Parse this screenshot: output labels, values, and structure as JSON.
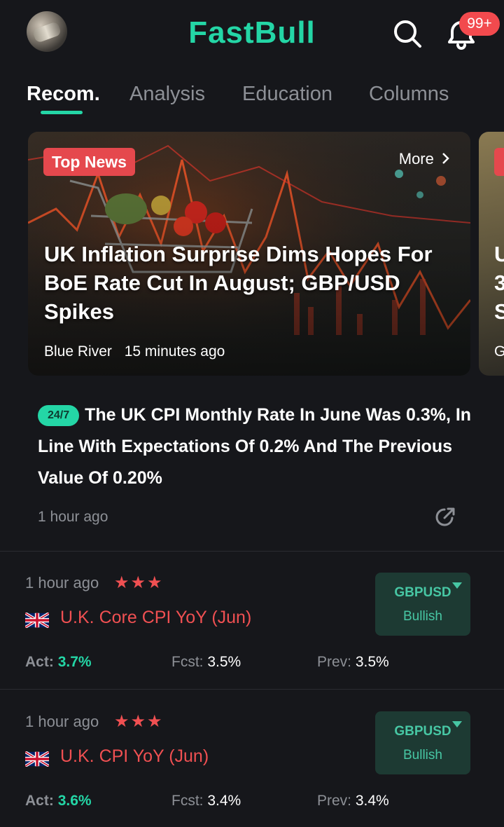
{
  "header": {
    "logo": "FastBull",
    "notification_count": "99+"
  },
  "tabs": [
    {
      "label": "Recom.",
      "active": true
    },
    {
      "label": "Analysis",
      "active": false
    },
    {
      "label": "Education",
      "active": false
    },
    {
      "label": "Columns",
      "active": false
    }
  ],
  "featured": {
    "tag": "Top News",
    "more": "More",
    "title": "UK Inflation Surprise Dims Hopes For BoE Rate Cut In August; GBP/USD Spikes",
    "author": "Blue River",
    "time": "15 minutes ago",
    "peek_title": "U\n3\nS",
    "peek_meta": "G"
  },
  "flash": {
    "tag": "24/7",
    "text": "The UK CPI Monthly Rate In June Was 0.3%, In Line With Expectations Of 0.2% And The Previous Value Of 0.20%",
    "time": "1 hour ago"
  },
  "events": [
    {
      "time": "1 hour ago",
      "stars": "★★★",
      "title": "U.K. Core CPI YoY (Jun)",
      "pair": "GBPUSD",
      "bias": "Bullish",
      "act_label": "Act:",
      "act": "3.7%",
      "fcst_label": "Fcst:",
      "fcst": "3.5%",
      "prev_label": "Prev:",
      "prev": "3.5%"
    },
    {
      "time": "1 hour ago",
      "stars": "★★★",
      "title": "U.K. CPI YoY (Jun)",
      "pair": "GBPUSD",
      "bias": "Bullish",
      "act_label": "Act:",
      "act": "3.6%",
      "fcst_label": "Fcst:",
      "fcst": "3.4%",
      "prev_label": "Prev:",
      "prev": "3.4%"
    }
  ],
  "colors": {
    "accent": "#24d6a6",
    "alert": "#f05052",
    "background": "#16171b"
  }
}
